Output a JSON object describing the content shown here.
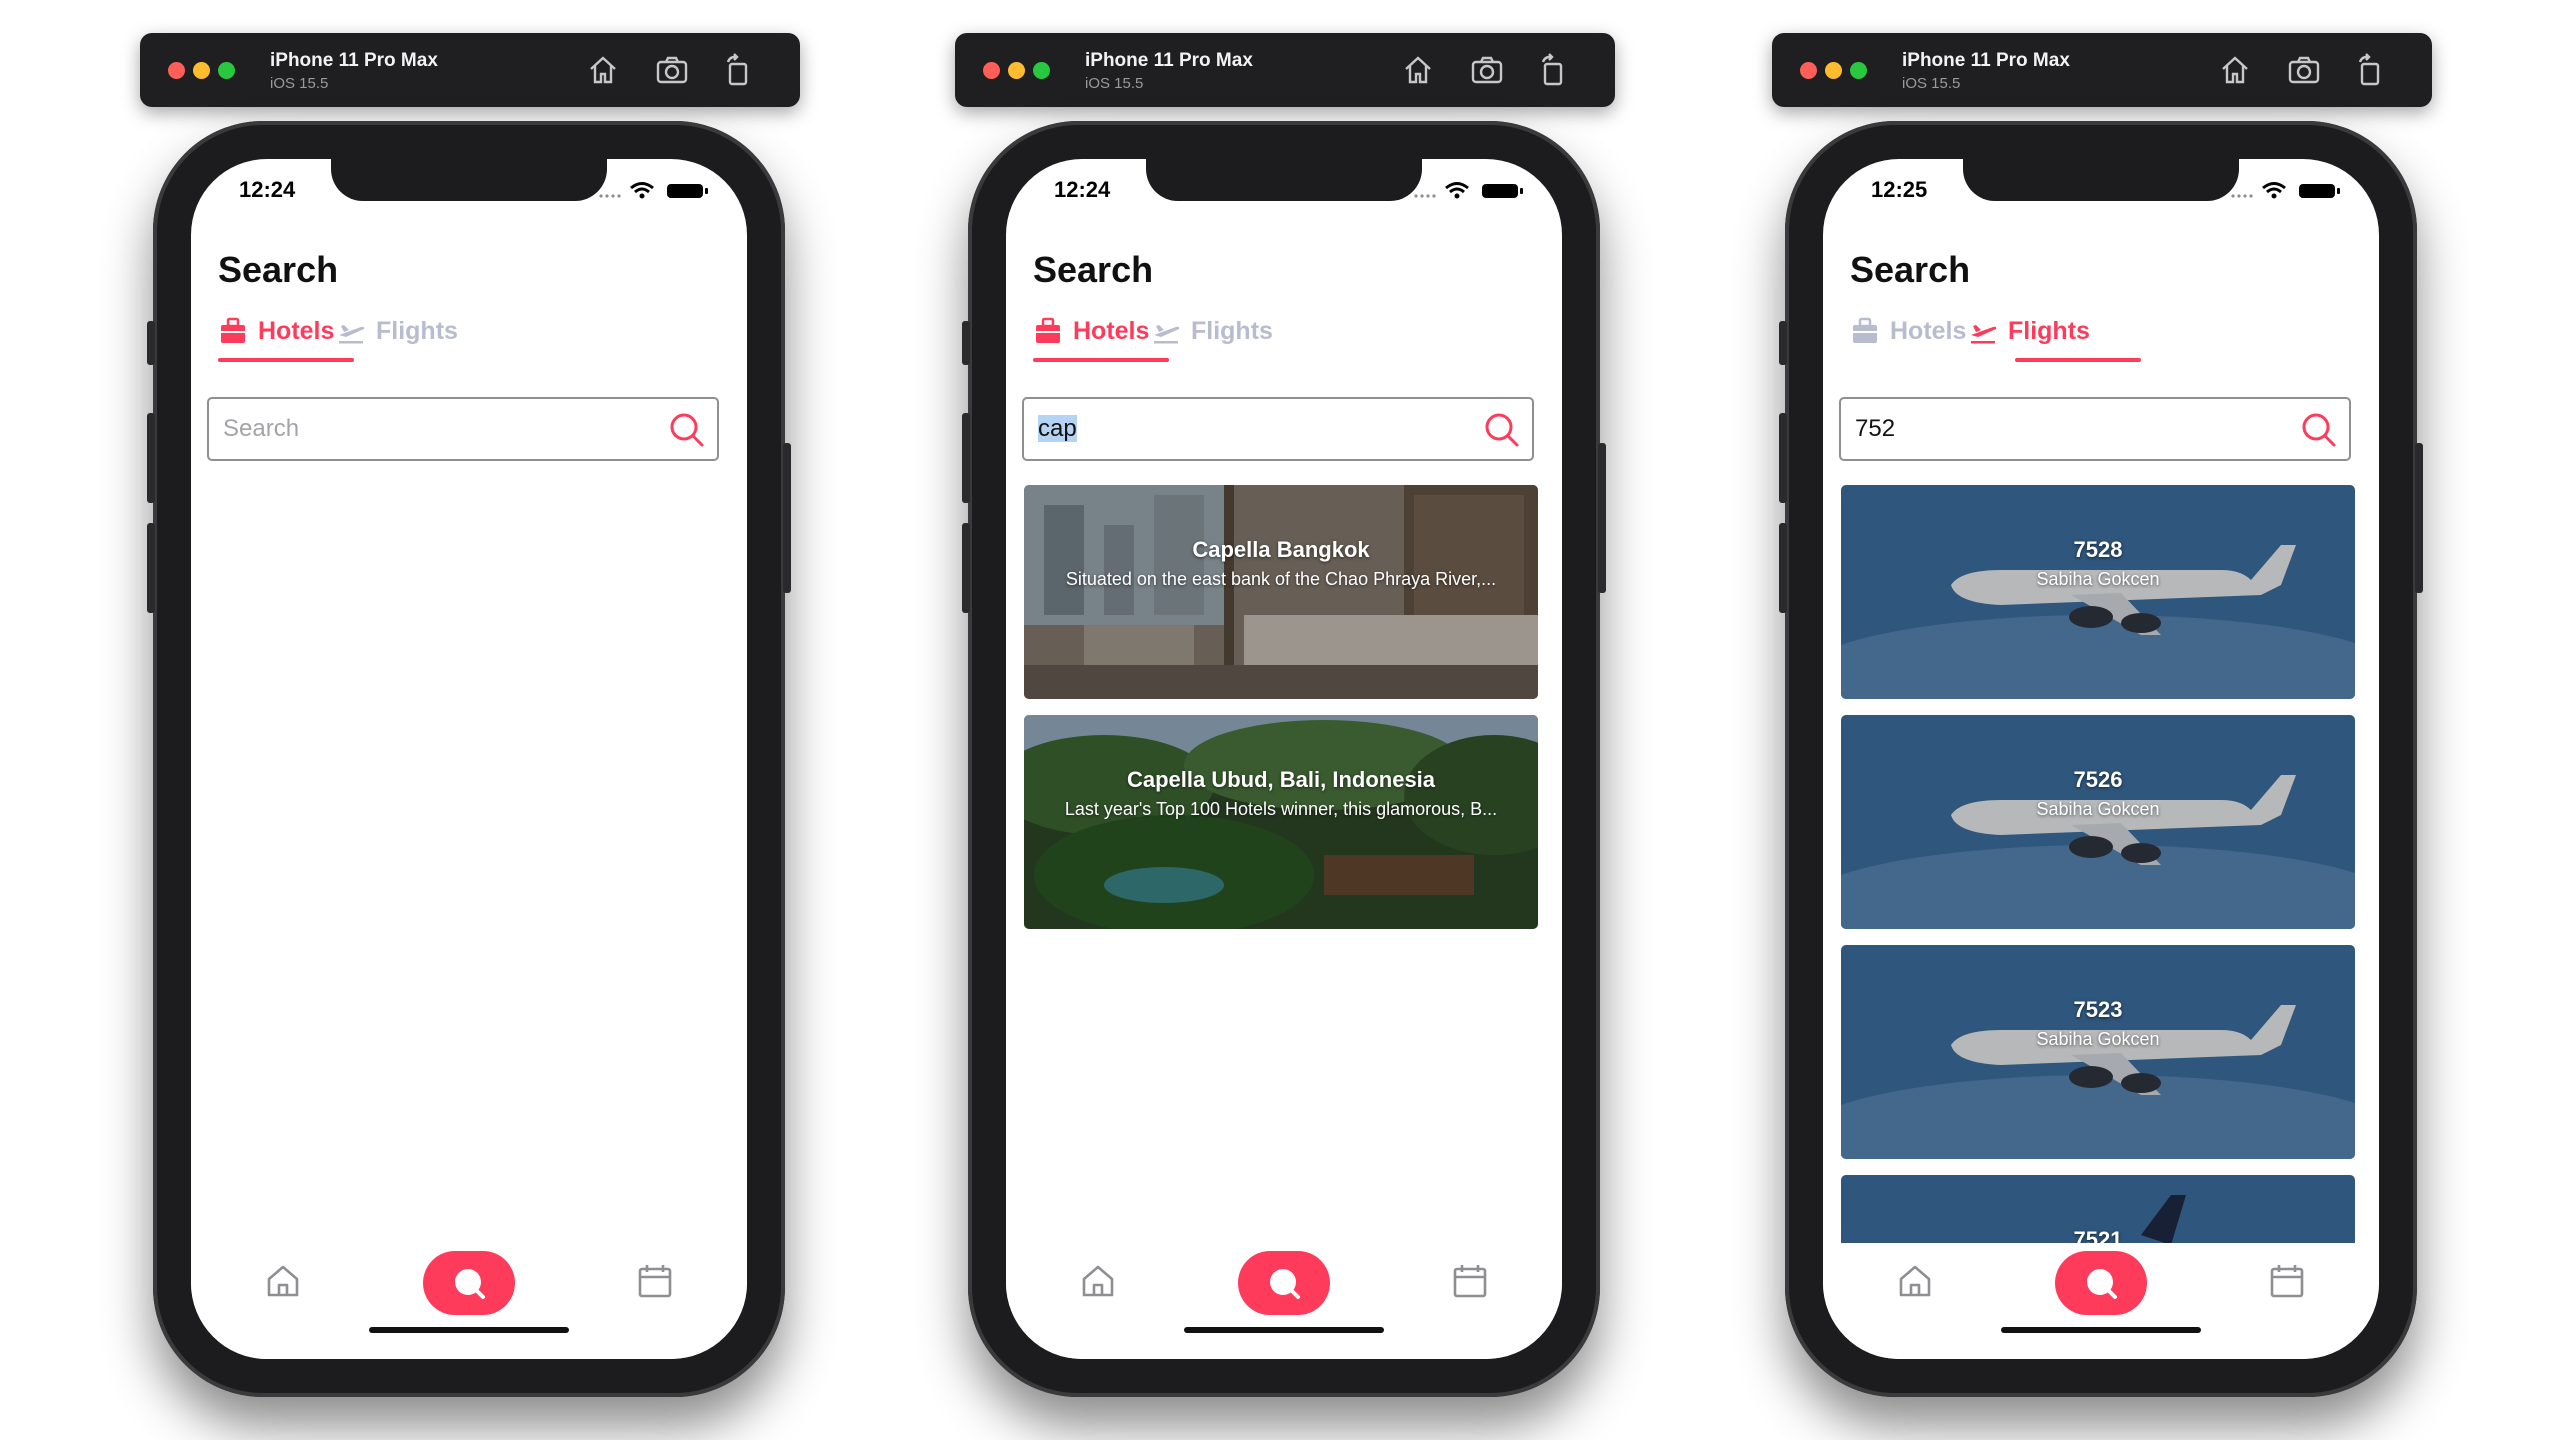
{
  "simulators": [
    {
      "device": "iPhone 11 Pro Max",
      "os": "iOS 15.5",
      "time": "12:24",
      "page_title": "Search",
      "tabs": [
        "Hotels",
        "Flights"
      ],
      "active_tab": "Hotels",
      "search": {
        "placeholder": "Search",
        "value": ""
      },
      "results": []
    },
    {
      "device": "iPhone 11 Pro Max",
      "os": "iOS 15.5",
      "time": "12:24",
      "page_title": "Search",
      "tabs": [
        "Hotels",
        "Flights"
      ],
      "active_tab": "Hotels",
      "search": {
        "placeholder": "Search",
        "value": "cap"
      },
      "results": [
        {
          "title": "Capella Bangkok",
          "subtitle": "Situated on the east bank of the Chao Phraya River,..."
        },
        {
          "title": "Capella Ubud, Bali, Indonesia",
          "subtitle": "Last year's Top 100 Hotels winner, this glamorous, B..."
        }
      ]
    },
    {
      "device": "iPhone 11 Pro Max",
      "os": "iOS 15.5",
      "time": "12:25",
      "page_title": "Search",
      "tabs": [
        "Hotels",
        "Flights"
      ],
      "active_tab": "Flights",
      "search": {
        "placeholder": "Search",
        "value": "752"
      },
      "results": [
        {
          "title": "7528",
          "subtitle": "Sabiha Gokcen"
        },
        {
          "title": "7526",
          "subtitle": "Sabiha Gokcen"
        },
        {
          "title": "7523",
          "subtitle": "Sabiha Gokcen"
        },
        {
          "title": "7521",
          "subtitle": ""
        }
      ]
    }
  ],
  "tabbar_icons": [
    "home-icon",
    "search-icon",
    "calendar-icon"
  ],
  "colors": {
    "accent": "#ff3b5c",
    "inactive": "#b8bccf",
    "sim_bar": "#1f1f21"
  }
}
